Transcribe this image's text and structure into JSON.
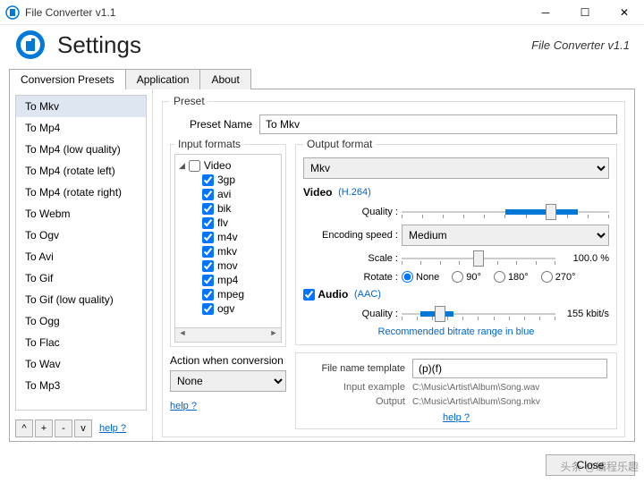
{
  "titlebar": {
    "title": "File Converter v1.1"
  },
  "header": {
    "title": "Settings",
    "version": "File Converter v1.1"
  },
  "tabs": {
    "t0": "Conversion Presets",
    "t1": "Application",
    "t2": "About"
  },
  "sidebar": {
    "items": [
      "To Mkv",
      "To Mp4",
      "To Mp4 (low quality)",
      "To Mp4 (rotate left)",
      "To Mp4 (rotate right)",
      "To Webm",
      "To Ogv",
      "To Avi",
      "To Gif",
      "To Gif (low quality)",
      "To Ogg",
      "To Flac",
      "To Wav",
      "To Mp3"
    ],
    "btn_up": "^",
    "btn_add": "+",
    "btn_remove": "-",
    "btn_down": "v",
    "help": "help ?"
  },
  "preset": {
    "legend": "Preset",
    "name_label": "Preset Name",
    "name_value": "To Mkv"
  },
  "input_formats": {
    "legend": "Input formats",
    "root": "Video",
    "items": [
      "3gp",
      "avi",
      "bik",
      "flv",
      "m4v",
      "mkv",
      "mov",
      "mp4",
      "mpeg",
      "ogv"
    ]
  },
  "action": {
    "label": "Action when conversion",
    "value": "None",
    "help": "help ?"
  },
  "output": {
    "legend": "Output format",
    "format_value": "Mkv",
    "video_label": "Video",
    "video_codec": "(H.264)",
    "quality_label": "Quality :",
    "encoding_label": "Encoding speed :",
    "encoding_value": "Medium",
    "scale_label": "Scale :",
    "scale_value": "100.0 %",
    "rotate_label": "Rotate :",
    "rotate_options": {
      "r0": "None",
      "r1": "90°",
      "r2": "180°",
      "r3": "270°"
    },
    "audio_label": "Audio",
    "audio_codec": "(AAC)",
    "audio_quality_label": "Quality :",
    "audio_quality_value": "155 kbit/s",
    "bitrate_note": "Recommended bitrate range in blue"
  },
  "template": {
    "name_label": "File name template",
    "name_value": "(p)(f)",
    "input_label": "Input example",
    "input_value": "C:\\Music\\Artist\\Album\\Song.wav",
    "output_label": "Output",
    "output_value": "C:\\Music\\Artist\\Album\\Song.mkv",
    "help": "help ?"
  },
  "footer": {
    "close": "Close"
  },
  "watermark": "头条 @编程乐趣"
}
